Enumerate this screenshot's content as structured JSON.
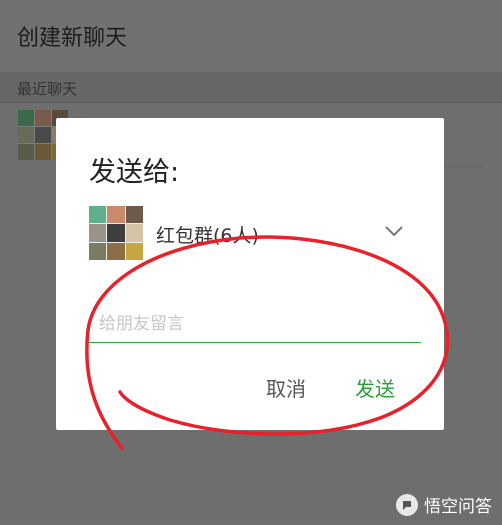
{
  "header": {
    "title": "创建新聊天"
  },
  "section": {
    "label": "最近聊天"
  },
  "dialog": {
    "title": "发送给:",
    "recipient": {
      "name": "红包群(6人)"
    },
    "input": {
      "placeholder": "给朋友留言",
      "value": ""
    },
    "cancel_label": "取消",
    "send_label": "发送"
  },
  "icons": {
    "chevron": "chevron-down-icon",
    "watermark_logo": "toutiao-logo-icon"
  },
  "colors": {
    "accent_green": "#2e9e3c",
    "annotation_red": "#e8212b",
    "overlay": "#6e6e6e"
  },
  "watermark": {
    "text": "悟空问答"
  }
}
